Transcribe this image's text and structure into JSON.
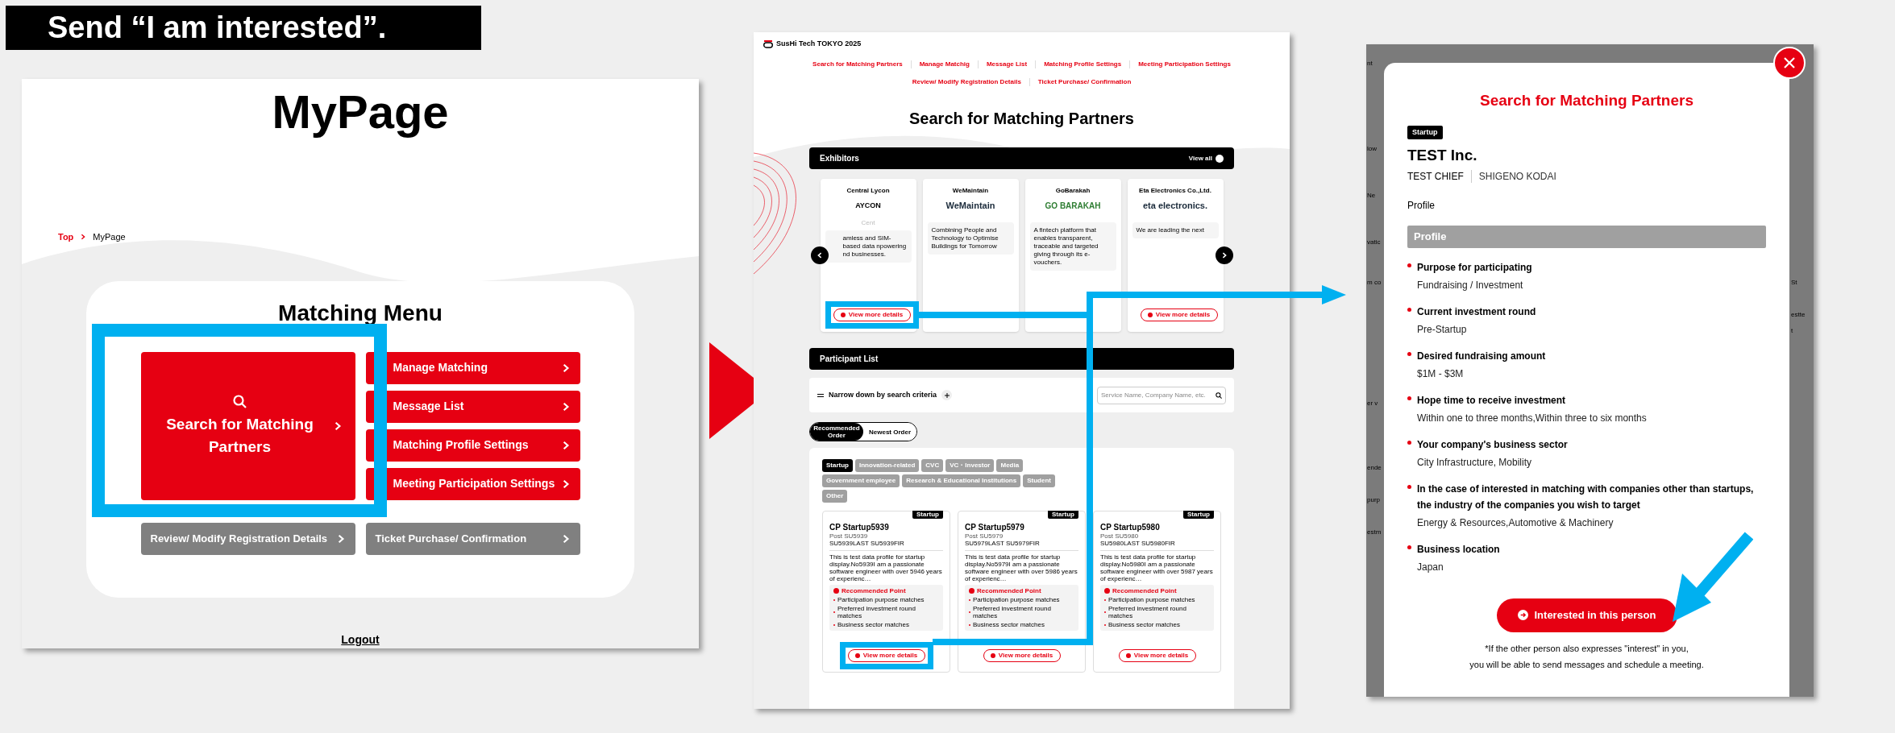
{
  "banner": {
    "title": "Send “I am interested”."
  },
  "mypage": {
    "title": "MyPage",
    "breadcrumb": {
      "link": "Top",
      "current": "MyPage"
    },
    "menu_title": "Matching Menu",
    "primary": {
      "label": "Search for Matching Partners"
    },
    "items": [
      {
        "label": "Manage Matching",
        "kind": "main"
      },
      {
        "label": "Message List",
        "kind": "main"
      },
      {
        "label": "Matching Profile Settings",
        "kind": "main"
      },
      {
        "label": "Meeting Participation Settings",
        "kind": "main"
      },
      {
        "label": "Review/ Modify Registration Details",
        "kind": "sub"
      },
      {
        "label": "Ticket Purchase/ Confirmation",
        "kind": "sub"
      }
    ],
    "logout": "Logout"
  },
  "search_page": {
    "logo": "SusHi Tech TOKYO 2025",
    "nav": [
      "Search for Matching Partners",
      "Manage Matchig",
      "Message List",
      "Matching Profile Settings",
      "Meeting Participation Settings",
      "Review/ Modify Registration Details",
      "Ticket Purchase/ Confirmation"
    ],
    "title": "Search for Matching Partners",
    "exhibitors": {
      "header": "Exhibitors",
      "view_all": "View all",
      "cards": [
        {
          "name": "Central Lycon",
          "logo": "AYCON",
          "caption": "Cent",
          "description": "amless and SIM-based data npowering nd businesses.",
          "action": "View more details",
          "highlighted": true
        },
        {
          "name": "WeMaintain",
          "logo": "WeMaintain",
          "description": "Combining People and Technology to Optimise Buildings for Tomorrow",
          "highlighted": false
        },
        {
          "name": "GoBarakah",
          "logo": "GO BARAKAH",
          "description": "A fintech platform that enables transparent, traceable and targeted giving through its e-vouchers.",
          "highlighted": false
        },
        {
          "name": "Eta Electronics Co.,Ltd.",
          "logo": "eta electronics.",
          "description": "We are leading the next",
          "action": "View more details",
          "highlighted": false
        }
      ]
    },
    "participants": {
      "header": "Participant List",
      "filter": "Narrow down by search criteria",
      "search_placeholder": "Service Name, Company Name, etc.",
      "sort": [
        {
          "label": "Recommended Order",
          "selected": true
        },
        {
          "label": "Newest Order",
          "selected": false
        }
      ],
      "categories": [
        {
          "label": "Startup",
          "selected": true
        },
        {
          "label": "Innovation-related",
          "selected": false
        },
        {
          "label": "CVC",
          "selected": false
        },
        {
          "label": "VC・Investor",
          "selected": false
        },
        {
          "label": "Media",
          "selected": false
        },
        {
          "label": "Government employee",
          "selected": false
        },
        {
          "label": "Research & Educational Institutions",
          "selected": false
        },
        {
          "label": "Student",
          "selected": false
        },
        {
          "label": "Other",
          "selected": false
        }
      ],
      "cards": [
        {
          "name": "CP Startup5939",
          "badge": "Startup",
          "post": "Post SU5939",
          "person": "SU5939LAST SU5939FIR",
          "description": "This is test data profile for startup display.No5939I am a passionate software engineer with over 5946 years of experienc…",
          "rec_title": "Recommended Point",
          "points": [
            "Participation purpose matches",
            "Preferred investment round matches",
            "Business sector matches"
          ],
          "action": "View more details",
          "highlighted": true
        },
        {
          "name": "CP Startup5979",
          "badge": "Startup",
          "post": "Post SU5979",
          "person": "SU5979LAST SU5979FIR",
          "description": "This is test data profile for startup display.No5979I am a passionate software engineer with over 5986 years of experienc…",
          "rec_title": "Recommended Point",
          "points": [
            "Participation purpose matches",
            "Preferred investment round matches",
            "Business sector matches"
          ],
          "action": "View more details",
          "highlighted": false
        },
        {
          "name": "CP Startup5980",
          "badge": "Startup",
          "post": "Post SU5980",
          "person": "SU5980LAST SU5980FIR",
          "description": "This is test data profile for startup display.No5980I am a passionate software engineer with over 5987 years of experienc…",
          "rec_title": "Recommended Point",
          "points": [
            "Participation purpose matches",
            "Preferred investment round matches",
            "Business sector matches"
          ],
          "action": "View more details",
          "highlighted": false
        }
      ]
    }
  },
  "modal": {
    "backdrop_left": [
      "nt",
      "low",
      "Ne",
      "vatic",
      "m co",
      "er v",
      "ende",
      "purp",
      "estm"
    ],
    "backdrop_right": [
      "St",
      "estte",
      "t"
    ],
    "title": "Search for Matching Partners",
    "badge": "Startup",
    "company": "TEST Inc.",
    "role": "TEST CHIEF",
    "person": "SHIGENO KODAI",
    "profile_label": "Profile",
    "section": "Profile",
    "fields": [
      {
        "label": "Purpose for participating",
        "value": "Fundraising / Investment"
      },
      {
        "label": "Current investment round",
        "value": "Pre-Startup"
      },
      {
        "label": "Desired fundraising amount",
        "value": "$1M - $3M"
      },
      {
        "label": "Hope time to receive investment",
        "value": "Within one to three months,Within three to six months"
      },
      {
        "label": "Your company's business sector",
        "value": "City Infrastructure, Mobility"
      },
      {
        "label": "In the case of interested in matching with companies other than startups, the industry of the companies you wish to target",
        "value": "Energy & Resources,Automotive & Machinery"
      },
      {
        "label": "Business location",
        "value": "Japan"
      }
    ],
    "button": "Interested in this person",
    "notes": [
      "*If the other person also expresses \"interest\" in you,",
      "you will be able to send messages and schedule a meeting."
    ]
  }
}
